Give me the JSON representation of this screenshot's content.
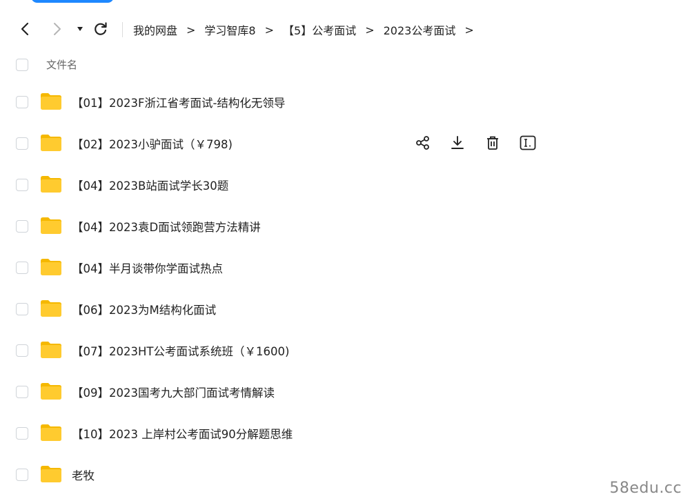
{
  "toolbar": {
    "back_icon": "chevron-left-icon",
    "forward_icon": "chevron-right-icon",
    "history_icon": "caret-down-icon",
    "refresh_icon": "refresh-icon"
  },
  "breadcrumb": {
    "items": [
      "我的网盘",
      "学习智库8",
      "【5】公考面试",
      "2023公考面试"
    ],
    "separator": ">"
  },
  "list_header": {
    "column_name": "文件名"
  },
  "files": [
    {
      "name": "【01】2023F浙江省考面试-结构化无领导",
      "type": "folder"
    },
    {
      "name": "【02】2023小驴面试（￥798)",
      "type": "folder"
    },
    {
      "name": "【04】2023B站面试学长30题",
      "type": "folder"
    },
    {
      "name": "【04】2023袁D面试领跑营方法精讲",
      "type": "folder"
    },
    {
      "name": "【04】半月谈带你学面试热点",
      "type": "folder"
    },
    {
      "name": "【06】2023为M结构化面试",
      "type": "folder"
    },
    {
      "name": "【07】2023HT公考面试系统班（￥1600)",
      "type": "folder"
    },
    {
      "name": "【09】2023国考九大部门面试考情解读",
      "type": "folder"
    },
    {
      "name": "【10】2023 上岸村公考面试90分解题思维",
      "type": "folder"
    },
    {
      "name": "老牧",
      "type": "folder"
    }
  ],
  "row_actions": [
    "share-icon",
    "download-icon",
    "delete-icon",
    "rename-icon"
  ],
  "watermark": "58edu.cc",
  "colors": {
    "accent": "#1e88ff",
    "folder": "#ffcb2f",
    "folder_tab": "#f5b800"
  }
}
